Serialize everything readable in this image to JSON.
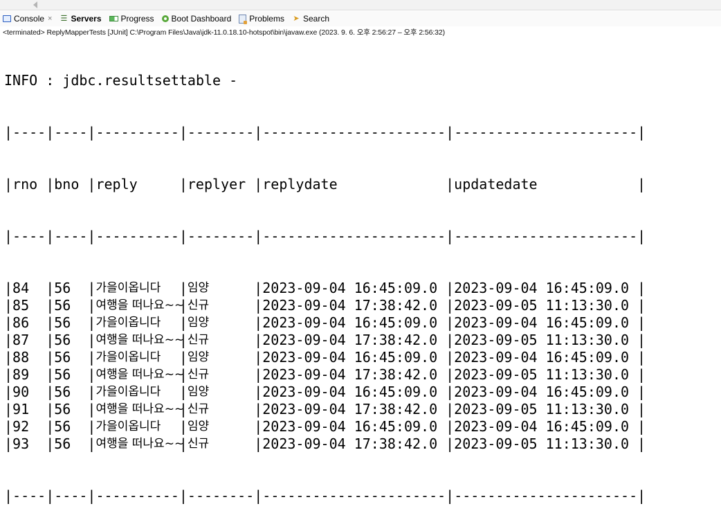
{
  "tabs": [
    {
      "label": "Console",
      "icon": "console-icon",
      "active": true,
      "closable": true
    },
    {
      "label": "Servers",
      "icon": "servers-icon",
      "bold": true
    },
    {
      "label": "Progress",
      "icon": "progress-icon"
    },
    {
      "label": "Boot Dashboard",
      "icon": "boot-dashboard-icon"
    },
    {
      "label": "Problems",
      "icon": "problems-icon"
    },
    {
      "label": "Search",
      "icon": "search-icon"
    }
  ],
  "status_line": "<terminated> ReplyMapperTests [JUnit] C:\\Program Files\\Java\\jdk-11.0.18.10-hotspot\\bin\\javaw.exe  (2023. 9. 6. 오후 2:56:27 – 오후 2:56:32)",
  "console": {
    "info_line": "INFO : jdbc.resultsettable - ",
    "separator_top": "|----|----|----------|--------|----------------------|----------------------|",
    "headers": [
      "rno",
      "bno",
      "reply",
      "replyer",
      "replydate",
      "updatedate"
    ],
    "separator_mid": "|----|----|----------|--------|----------------------|----------------------|",
    "rows": [
      [
        "84",
        "56",
        "가을이옵니다",
        "임양",
        "2023-09-04 16:45:09.0",
        "2023-09-04 16:45:09.0"
      ],
      [
        "85",
        "56",
        "여행을 떠나요~~",
        "신규",
        "2023-09-04 17:38:42.0",
        "2023-09-05 11:13:30.0"
      ],
      [
        "86",
        "56",
        "가을이옵니다",
        "임양",
        "2023-09-04 16:45:09.0",
        "2023-09-04 16:45:09.0"
      ],
      [
        "87",
        "56",
        "여행을 떠나요~~",
        "신규",
        "2023-09-04 17:38:42.0",
        "2023-09-05 11:13:30.0"
      ],
      [
        "88",
        "56",
        "가을이옵니다",
        "임양",
        "2023-09-04 16:45:09.0",
        "2023-09-04 16:45:09.0"
      ],
      [
        "89",
        "56",
        "여행을 떠나요~~",
        "신규",
        "2023-09-04 17:38:42.0",
        "2023-09-05 11:13:30.0"
      ],
      [
        "90",
        "56",
        "가을이옵니다",
        "임양",
        "2023-09-04 16:45:09.0",
        "2023-09-04 16:45:09.0"
      ],
      [
        "91",
        "56",
        "여행을 떠나요~~",
        "신규",
        "2023-09-04 17:38:42.0",
        "2023-09-05 11:13:30.0"
      ],
      [
        "92",
        "56",
        "가을이옵니다",
        "임양",
        "2023-09-04 16:45:09.0",
        "2023-09-04 16:45:09.0"
      ],
      [
        "93",
        "56",
        "여행을 떠나요~~",
        "신규",
        "2023-09-04 17:38:42.0",
        "2023-09-05 11:13:30.0"
      ]
    ],
    "separator_bottom": "|----|----|----------|--------|----------------------|----------------------|"
  }
}
